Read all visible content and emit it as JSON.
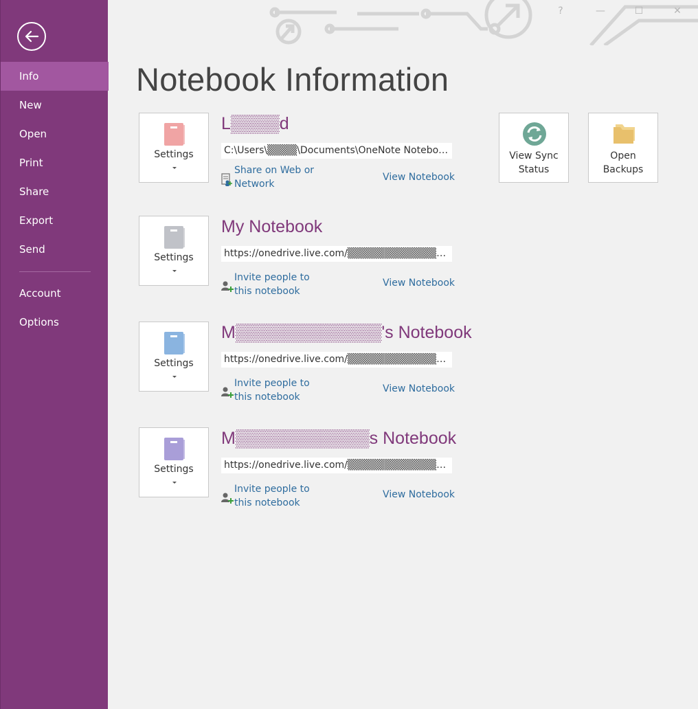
{
  "window": {
    "help": "?",
    "minimize": "—",
    "maximize": "☐",
    "close": "✕"
  },
  "sidebar": {
    "items": [
      {
        "label": "Info"
      },
      {
        "label": "New"
      },
      {
        "label": "Open"
      },
      {
        "label": "Print"
      },
      {
        "label": "Share"
      },
      {
        "label": "Export"
      },
      {
        "label": "Send"
      },
      {
        "label": "Account"
      },
      {
        "label": "Options"
      }
    ],
    "active_color": "#a257a0",
    "background_color": "#80397b"
  },
  "main": {
    "title": "Notebook Information",
    "notebooks": [
      {
        "name": "L▒▒▒▒d",
        "path": "C:\\Users\\▒▒▒▒\\Documents\\OneNote Notebooks\\",
        "settings_label": "Settings",
        "share_label": "Share on Web or Network",
        "view_label": "View Notebook",
        "book_color": "#f0a4a4",
        "share_icon": "share-web-icon"
      },
      {
        "name": "My Notebook",
        "path": "https://onedrive.live.com/▒▒▒▒▒▒▒▒▒▒▒▒▒▒▒▒▒▒▒▒",
        "settings_label": "Settings",
        "share_label": "Invite people to this notebook",
        "view_label": "View Notebook",
        "book_color": "#c0c2c8",
        "share_icon": "invite-people-icon"
      },
      {
        "name": "M▒▒▒▒▒▒▒▒▒▒▒▒'s Notebook",
        "path": "https://onedrive.live.com/▒▒▒▒▒▒▒▒▒▒▒▒▒▒▒▒▒▒▒▒",
        "settings_label": "Settings",
        "share_label": "Invite people to this notebook",
        "view_label": "View Notebook",
        "book_color": "#8ab4e0",
        "share_icon": "invite-people-icon"
      },
      {
        "name": "M▒▒▒▒▒▒▒▒▒▒▒s Notebook",
        "path": "https://onedrive.live.com/▒▒▒▒▒▒▒▒▒▒▒▒▒▒▒▒▒▒▒▒",
        "settings_label": "Settings",
        "share_label": "Invite people to this notebook",
        "view_label": "View Notebook",
        "book_color": "#a99ed8",
        "share_icon": "invite-people-icon"
      }
    ],
    "actions": {
      "sync_label": "View Sync Status",
      "backups_label": "Open Backups",
      "sync_color": "#6fa796",
      "backups_color": "#e8c06c"
    },
    "link_color": "#2e6c9e",
    "notebook_name_color": "#80397b"
  }
}
